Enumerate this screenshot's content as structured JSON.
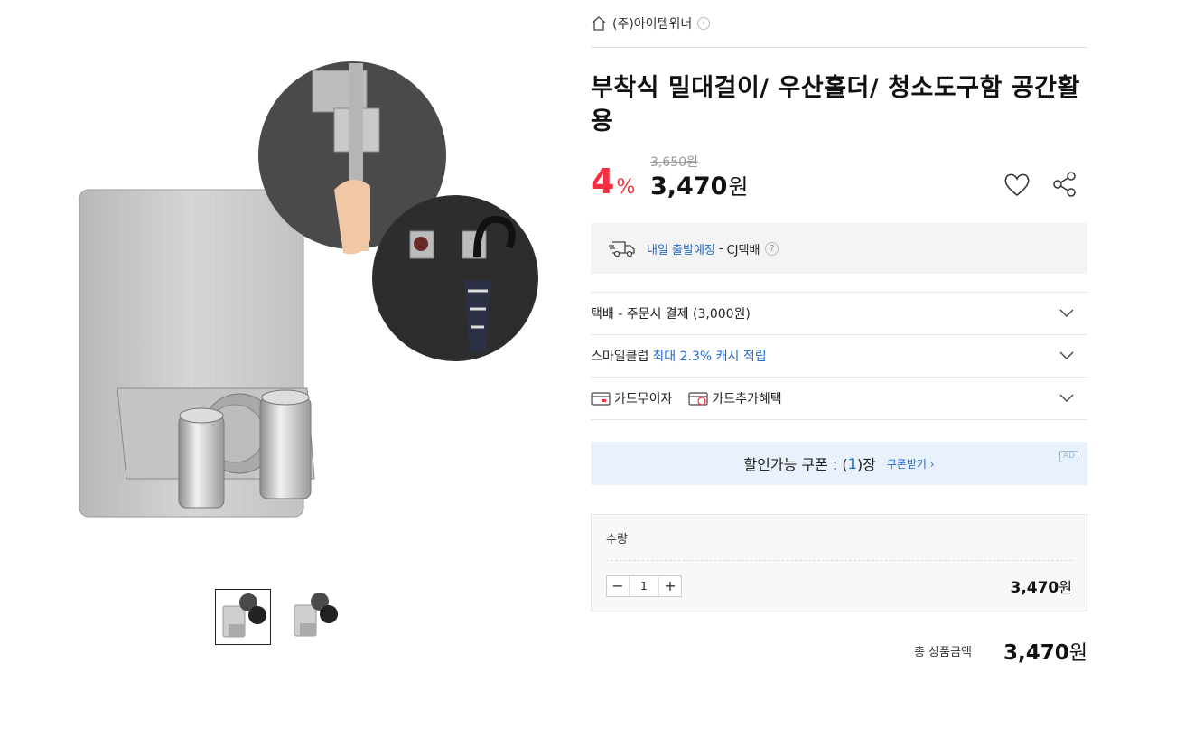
{
  "seller": {
    "name": "(주)아이템위너"
  },
  "product": {
    "title": "부착식 밀대걸이/ 우산홀더/ 청소도구함 공간활용",
    "discount_number": "4",
    "discount_unit": "%",
    "original_price": "3,650원",
    "sale_price_number": "3,470",
    "currency": "원"
  },
  "delivery": {
    "highlight": "내일 출발예정",
    "separator": "-",
    "carrier": "CJ택배",
    "help": "?"
  },
  "options": {
    "shipping": "택배 - 주문시 결제 (3,000원)",
    "smileclub_prefix": "스마일클럽",
    "smileclub_highlight": "최대 2.3% 캐시 적립",
    "card_installment": "카드무이자",
    "card_benefit": "카드추가혜택"
  },
  "coupon": {
    "prefix": "할인가능 쿠폰 : (",
    "count": "1",
    "suffix": ")장",
    "action": "쿠폰받기 ›",
    "ad_badge": "AD"
  },
  "quantity": {
    "label": "수량",
    "minus": "−",
    "value": "1",
    "plus": "+",
    "line_price_number": "3,470",
    "currency": "원"
  },
  "total": {
    "label": "총 상품금액",
    "amount_number": "3,470",
    "currency": "원"
  },
  "colors": {
    "discount_red": "#f43142",
    "link_blue": "#2169cf",
    "coupon_bg": "#e9f2fc"
  },
  "gallery": {
    "thumbnail_count": 2,
    "selected_index": 0
  }
}
